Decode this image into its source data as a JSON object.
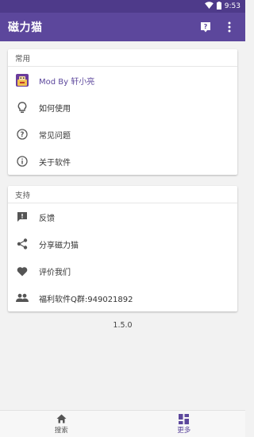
{
  "status_bar": {
    "time": "9:53"
  },
  "app_bar": {
    "title": "磁力猫"
  },
  "section_common": {
    "header": "常用",
    "items": [
      {
        "label": "Mod By 轩小亮",
        "icon": "app-logo-icon"
      },
      {
        "label": "如何使用",
        "icon": "lightbulb-icon"
      },
      {
        "label": "常见问题",
        "icon": "help-circle-icon"
      },
      {
        "label": "关于软件",
        "icon": "info-icon"
      }
    ]
  },
  "section_support": {
    "header": "支持",
    "items": [
      {
        "label": "反馈",
        "icon": "feedback-icon"
      },
      {
        "label": "分享磁力猫",
        "icon": "share-icon"
      },
      {
        "label": "评价我们",
        "icon": "heart-icon"
      },
      {
        "label": "福利软件Q群:949021892",
        "icon": "group-icon"
      }
    ]
  },
  "version": "1.5.0",
  "bottom_nav": {
    "items": [
      {
        "label": "搜索",
        "icon": "home-icon"
      },
      {
        "label": "更多",
        "icon": "dashboard-icon",
        "active": true
      }
    ]
  },
  "colors": {
    "primary": "#5c479c",
    "status_bar": "#4e3a8a"
  }
}
